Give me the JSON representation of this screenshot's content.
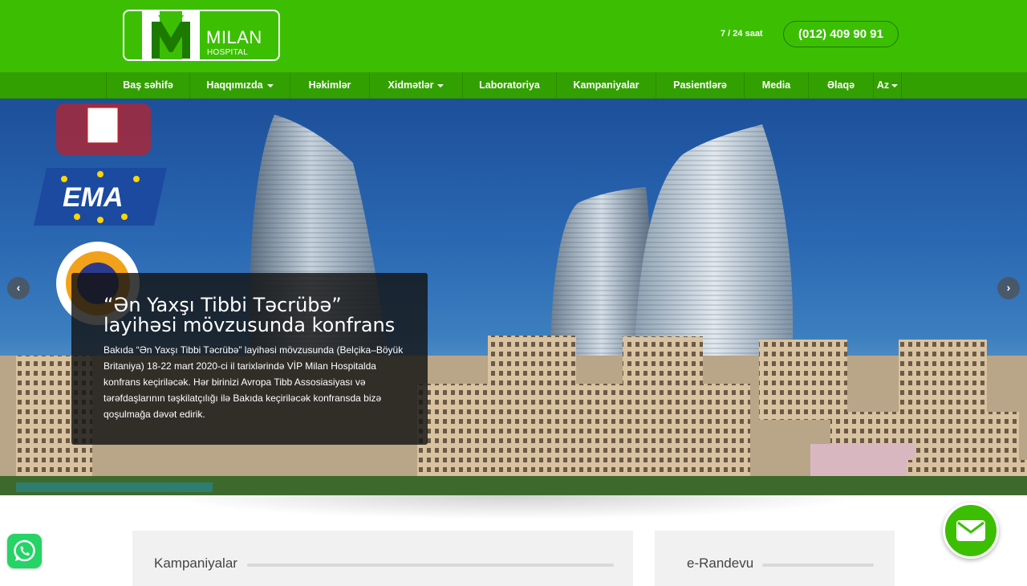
{
  "header": {
    "logo_name": "MILAN",
    "logo_sub": "HOSPITAL",
    "hours": "7 / 24 saat",
    "phone": "(012) 409 90 91"
  },
  "nav": {
    "items": [
      {
        "label": "Baş səhifə",
        "dropdown": false
      },
      {
        "label": "Haqqımızda",
        "dropdown": true
      },
      {
        "label": "Həkimlər",
        "dropdown": false
      },
      {
        "label": "Xidmətlər",
        "dropdown": true
      },
      {
        "label": "Laboratoriya",
        "dropdown": false
      },
      {
        "label": "Kampaniyalar",
        "dropdown": false
      },
      {
        "label": "Pasientlərə",
        "dropdown": false
      },
      {
        "label": "Media",
        "dropdown": false
      },
      {
        "label": "Əlaqə",
        "dropdown": false
      },
      {
        "label": "Az",
        "dropdown": true
      }
    ]
  },
  "hero": {
    "ema_logo_text": "EMA",
    "caption_title_line1": "“Ən Yaxşı Tibbi Təcrübə”",
    "caption_title_line2": "layihəsi mövzusunda konfrans",
    "caption_text": "Bakıda “Ən Yaxşı Tibbi Təcrübə” layihəsi mövzusunda (Belçika–Böyük Britaniya) 18-22 mart 2020-ci il tarixlərində VİP Milan Hospitalda konfrans keçiriləcək. Hər birinizi Avropa Tibb Assosiasiyası və tərəfdaşlarının təşkilatçılığı ilə Bakıda keçiriləcək konfransda bizə qoşulmağa dəvət edirik.",
    "prev_icon": "chevron-left-icon",
    "next_icon": "chevron-right-icon"
  },
  "panels": {
    "left_title": "Kampaniyalar",
    "right_title": "e-Randevu"
  },
  "floating": {
    "whatsapp_icon": "whatsapp-icon",
    "mail_icon": "mail-icon"
  },
  "colors": {
    "brand_green": "#3cbf03",
    "nav_green": "#33a002",
    "whatsapp_green": "#25d366"
  }
}
